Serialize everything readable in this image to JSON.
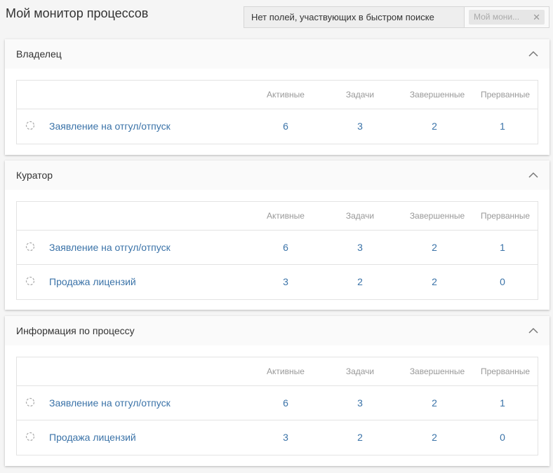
{
  "page": {
    "title": "Мой монитор процессов"
  },
  "quick_search": {
    "text": "Нет полей, участвующих в быстром поиске",
    "chip": "Мой мони...",
    "chip_close": "✕"
  },
  "columns": [
    "Активные",
    "Задачи",
    "Завершенные",
    "Прерванные"
  ],
  "icons": {
    "process": "process-spinner-icon",
    "collapse": "chevron-up-icon"
  },
  "panels": [
    {
      "title": "Владелец",
      "rows": [
        {
          "name": "Заявление на отгул/отпуск",
          "active": "6",
          "tasks": "3",
          "completed": "2",
          "aborted": "1"
        }
      ]
    },
    {
      "title": "Куратор",
      "rows": [
        {
          "name": "Заявление на отгул/отпуск",
          "active": "6",
          "tasks": "3",
          "completed": "2",
          "aborted": "1"
        },
        {
          "name": "Продажа лицензий",
          "active": "3",
          "tasks": "2",
          "completed": "2",
          "aborted": "0"
        }
      ]
    },
    {
      "title": "Информация по процессу",
      "rows": [
        {
          "name": "Заявление на отгул/отпуск",
          "active": "6",
          "tasks": "3",
          "completed": "2",
          "aborted": "1"
        },
        {
          "name": "Продажа лицензий",
          "active": "3",
          "tasks": "2",
          "completed": "2",
          "aborted": "0"
        }
      ]
    }
  ]
}
